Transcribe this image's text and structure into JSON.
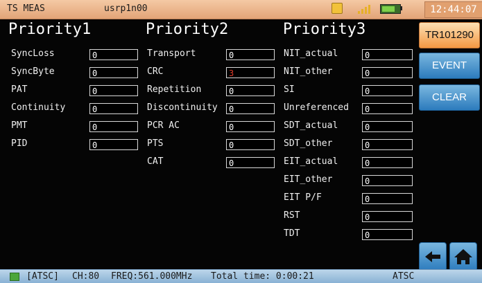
{
  "titlebar": {
    "mode": "TS MEAS",
    "user": "usrp1n00",
    "time": "12:44:07",
    "icons": [
      "usb-icon",
      "antenna-signal-icon",
      "battery-icon"
    ],
    "accent": "#e2a478"
  },
  "columns": [
    {
      "title": "Priority1",
      "items": [
        {
          "label": "SyncLoss",
          "value": "0"
        },
        {
          "label": "SyncByte",
          "value": "0"
        },
        {
          "label": "PAT",
          "value": "0"
        },
        {
          "label": "Continuity",
          "value": "0"
        },
        {
          "label": "PMT",
          "value": "0"
        },
        {
          "label": "PID",
          "value": "0"
        }
      ]
    },
    {
      "title": "Priority2",
      "items": [
        {
          "label": "Transport",
          "value": "0"
        },
        {
          "label": "CRC",
          "value": "3"
        },
        {
          "label": "Repetition",
          "value": "0"
        },
        {
          "label": "Discontinuity",
          "value": "0"
        },
        {
          "label": "PCR AC",
          "value": "0"
        },
        {
          "label": "PTS",
          "value": "0"
        },
        {
          "label": "CAT",
          "value": "0"
        }
      ]
    },
    {
      "title": "Priority3",
      "items": [
        {
          "label": "NIT_actual",
          "value": "0"
        },
        {
          "label": "NIT_other",
          "value": "0"
        },
        {
          "label": "SI",
          "value": "0"
        },
        {
          "label": "Unreferenced",
          "value": "0"
        },
        {
          "label": "SDT_actual",
          "value": "0"
        },
        {
          "label": "SDT_other",
          "value": "0"
        },
        {
          "label": "EIT_actual",
          "value": "0"
        },
        {
          "label": "EIT_other",
          "value": "0"
        },
        {
          "label": "EIT P/F",
          "value": "0"
        },
        {
          "label": "RST",
          "value": "0"
        },
        {
          "label": "TDT",
          "value": "0"
        }
      ]
    }
  ],
  "buttons": {
    "tr101290": "TR101290",
    "event": "EVENT",
    "clear": "CLEAR"
  },
  "footer": {
    "standard": "[ATSC]",
    "channel": "CH:80",
    "frequency": "FREQ:561.000MHz",
    "total_time": "Total time: 0:00:21",
    "mode": "ATSC"
  },
  "colors": {
    "error_value": "#e23c2a",
    "button_blue": "#2c7bbd",
    "button_active": "#f39843"
  }
}
